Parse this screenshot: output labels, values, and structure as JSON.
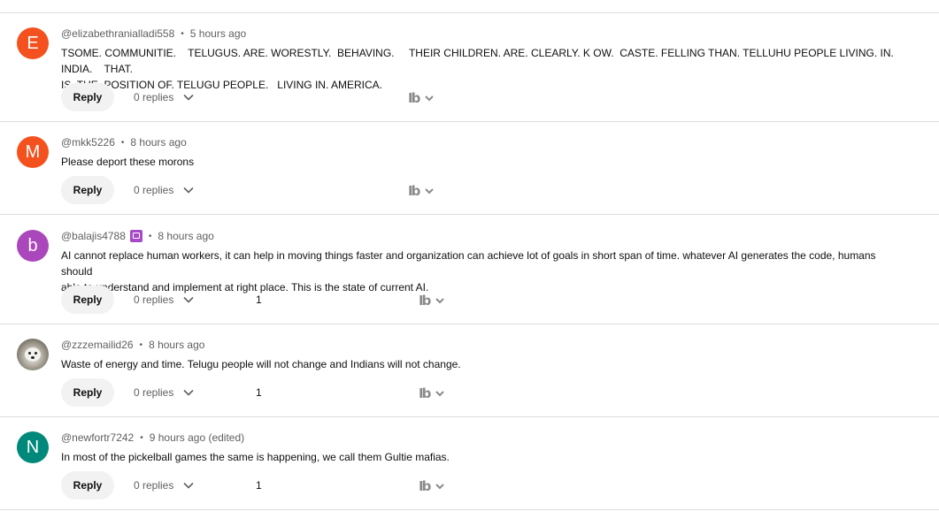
{
  "comments": [
    {
      "avatar_letter": "E",
      "avatar_color": "#f4511e",
      "handle": "@elizabethranialladi558",
      "time": "5 hours ago",
      "text": "TSOME. COMMUNITIE.    TELUGUS. ARE. WORESTLY.  BEHAVING.     THEIR CHILDREN. ARE. CLEARLY. K OW.  CASTE. FELLING THAN. TELLUHU PEOPLE LIVING. IN. INDIA.    THAT.\nIS. THE. POSITION OF. TELUGU PEOPLE.   LIVING IN. AMERICA.",
      "reply_label": "Reply",
      "replies_label": "0 replies",
      "likes": "",
      "tb_icon": "tb-translate-icon"
    },
    {
      "avatar_letter": "M",
      "avatar_color": "#f4511e",
      "handle": "@mkk5226",
      "time": "8 hours ago",
      "text": "Please deport these morons",
      "reply_label": "Reply",
      "replies_label": "0 replies",
      "likes": "",
      "tb_icon": "tb-translate-icon"
    },
    {
      "avatar_letter": "b",
      "avatar_color": "#ab47bc",
      "handle": "@balajis4788",
      "time": "8 hours ago",
      "text": "AI cannot replace human workers, it can help in moving things faster and organization can achieve lot of goals in short span of time. whatever AI generates the code, humans should\nable to understand and implement at right place. This is the state of current AI.",
      "reply_label": "Reply",
      "replies_label": "0 replies",
      "likes": "1",
      "tb_icon": "tb-translate-icon"
    },
    {
      "avatar_letter": "",
      "avatar_color": "#9e978a",
      "handle": "@zzzemailid26",
      "time": "8 hours ago",
      "text": "Waste of energy and time. Telugu people will not change and Indians will not change.",
      "reply_label": "Reply",
      "replies_label": "0 replies",
      "likes": "1",
      "tb_icon": "tb-translate-icon"
    },
    {
      "avatar_letter": "N",
      "avatar_color": "#00897b",
      "handle": "@newfortr7242",
      "time": "9 hours ago (edited)",
      "text": "In most of the pickelball games the same is happening, we call them Gultie mafias.",
      "reply_label": "Reply",
      "replies_label": "0 replies",
      "likes": "1",
      "tb_icon": "tb-translate-icon"
    }
  ],
  "colors": {
    "meta": "#606060",
    "text": "#0f0f0f",
    "button_bg": "#f2f2f2",
    "badge": "#a64ac9"
  }
}
